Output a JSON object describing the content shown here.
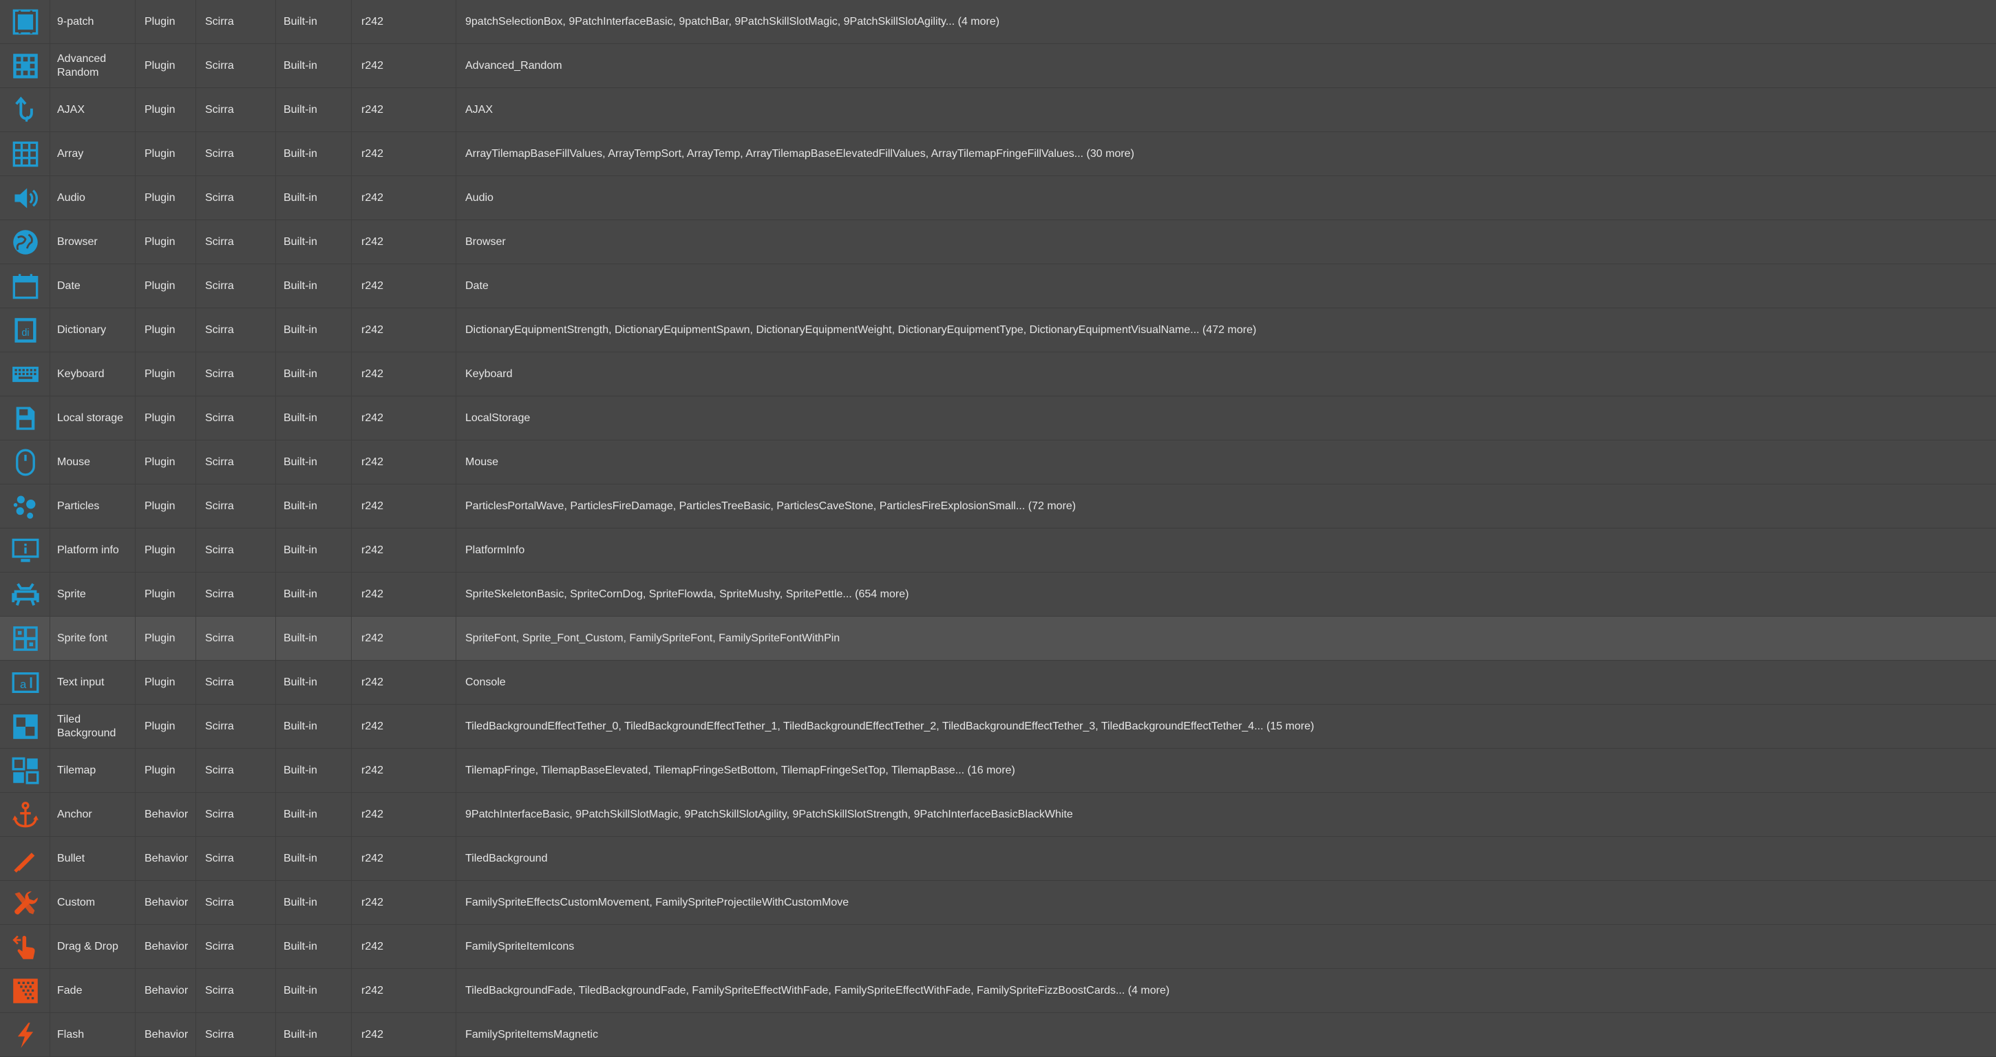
{
  "colors": {
    "plugin_icon": "#1f9ad0",
    "behavior_icon": "#e8501a",
    "row_bg": "#474747",
    "selected_row_bg": "#535353"
  },
  "rows": [
    {
      "name": "9-patch",
      "type": "Plugin",
      "author": "Scirra",
      "version": "Built-in",
      "revision": "r242",
      "used_by": "9patchSelectionBox, 9PatchInterfaceBasic, 9patchBar, 9PatchSkillSlotMagic, 9PatchSkillSlotAgility... (4 more)",
      "icon": "nine-patch-icon"
    },
    {
      "name": "Advanced Random",
      "type": "Plugin",
      "author": "Scirra",
      "version": "Built-in",
      "revision": "r242",
      "used_by": "Advanced_Random",
      "icon": "dice-grid-icon"
    },
    {
      "name": "AJAX",
      "type": "Plugin",
      "author": "Scirra",
      "version": "Built-in",
      "revision": "r242",
      "used_by": "AJAX",
      "icon": "ajax-arrows-icon"
    },
    {
      "name": "Array",
      "type": "Plugin",
      "author": "Scirra",
      "version": "Built-in",
      "revision": "r242",
      "used_by": "ArrayTilemapBaseFillValues, ArrayTempSort, ArrayTemp, ArrayTilemapBaseElevatedFillValues, ArrayTilemapFringeFillValues... (30 more)",
      "icon": "grid-icon"
    },
    {
      "name": "Audio",
      "type": "Plugin",
      "author": "Scirra",
      "version": "Built-in",
      "revision": "r242",
      "used_by": "Audio",
      "icon": "speaker-icon"
    },
    {
      "name": "Browser",
      "type": "Plugin",
      "author": "Scirra",
      "version": "Built-in",
      "revision": "r242",
      "used_by": "Browser",
      "icon": "globe-icon"
    },
    {
      "name": "Date",
      "type": "Plugin",
      "author": "Scirra",
      "version": "Built-in",
      "revision": "r242",
      "used_by": "Date",
      "icon": "calendar-icon"
    },
    {
      "name": "Dictionary",
      "type": "Plugin",
      "author": "Scirra",
      "version": "Built-in",
      "revision": "r242",
      "used_by": "DictionaryEquipmentStrength, DictionaryEquipmentSpawn, DictionaryEquipmentWeight, DictionaryEquipmentType, DictionaryEquipmentVisualName... (472 more)",
      "icon": "book-icon"
    },
    {
      "name": "Keyboard",
      "type": "Plugin",
      "author": "Scirra",
      "version": "Built-in",
      "revision": "r242",
      "used_by": "Keyboard",
      "icon": "keyboard-icon"
    },
    {
      "name": "Local storage",
      "type": "Plugin",
      "author": "Scirra",
      "version": "Built-in",
      "revision": "r242",
      "used_by": "LocalStorage",
      "icon": "storage-icon"
    },
    {
      "name": "Mouse",
      "type": "Plugin",
      "author": "Scirra",
      "version": "Built-in",
      "revision": "r242",
      "used_by": "Mouse",
      "icon": "mouse-icon"
    },
    {
      "name": "Particles",
      "type": "Plugin",
      "author": "Scirra",
      "version": "Built-in",
      "revision": "r242",
      "used_by": "ParticlesPortalWave, ParticlesFireDamage, ParticlesTreeBasic, ParticlesCaveStone, ParticlesFireExplosionSmall... (72 more)",
      "icon": "particles-icon"
    },
    {
      "name": "Platform info",
      "type": "Plugin",
      "author": "Scirra",
      "version": "Built-in",
      "revision": "r242",
      "used_by": "PlatformInfo",
      "icon": "monitor-info-icon"
    },
    {
      "name": "Sprite",
      "type": "Plugin",
      "author": "Scirra",
      "version": "Built-in",
      "revision": "r242",
      "used_by": "SpriteSkeletonBasic, SpriteCornDog, SpriteFlowda, SpriteMushy, SpritePettle... (654 more)",
      "icon": "invader-icon"
    },
    {
      "name": "Sprite font",
      "type": "Plugin",
      "author": "Scirra",
      "version": "Built-in",
      "revision": "r242",
      "used_by": "SpriteFont, Sprite_Font_Custom, FamilySpriteFont, FamilySpriteFontWithPin",
      "icon": "sprite-font-icon",
      "selected": true
    },
    {
      "name": "Text input",
      "type": "Plugin",
      "author": "Scirra",
      "version": "Built-in",
      "revision": "r242",
      "used_by": "Console",
      "icon": "text-input-icon"
    },
    {
      "name": "Tiled Background",
      "type": "Plugin",
      "author": "Scirra",
      "version": "Built-in",
      "revision": "r242",
      "used_by": "TiledBackgroundEffectTether_0, TiledBackgroundEffectTether_1, TiledBackgroundEffectTether_2, TiledBackgroundEffectTether_3, TiledBackgroundEffectTether_4... (15 more)",
      "icon": "checker-icon"
    },
    {
      "name": "Tilemap",
      "type": "Plugin",
      "author": "Scirra",
      "version": "Built-in",
      "revision": "r242",
      "used_by": "TilemapFringe, TilemapBaseElevated, TilemapFringeSetBottom, TilemapFringeSetTop, TilemapBase... (16 more)",
      "icon": "tilemap-icon"
    },
    {
      "name": "Anchor",
      "type": "Behavior",
      "author": "Scirra",
      "version": "Built-in",
      "revision": "r242",
      "used_by": "9PatchInterfaceBasic, 9PatchSkillSlotMagic, 9PatchSkillSlotAgility, 9PatchSkillSlotStrength, 9PatchInterfaceBasicBlackWhite",
      "icon": "anchor-icon"
    },
    {
      "name": "Bullet",
      "type": "Behavior",
      "author": "Scirra",
      "version": "Built-in",
      "revision": "r242",
      "used_by": "TiledBackground",
      "icon": "bullet-icon"
    },
    {
      "name": "Custom",
      "type": "Behavior",
      "author": "Scirra",
      "version": "Built-in",
      "revision": "r242",
      "used_by": "FamilySpriteEffectsCustomMovement, FamilySpriteProjectileWithCustomMove",
      "icon": "wrench-icon"
    },
    {
      "name": "Drag & Drop",
      "type": "Behavior",
      "author": "Scirra",
      "version": "Built-in",
      "revision": "r242",
      "used_by": "FamilySpriteItemIcons",
      "icon": "drag-hand-icon"
    },
    {
      "name": "Fade",
      "type": "Behavior",
      "author": "Scirra",
      "version": "Built-in",
      "revision": "r242",
      "used_by": "TiledBackgroundFade, TiledBackgroundFade, FamilySpriteEffectWithFade, FamilySpriteEffectWithFade, FamilySpriteFizzBoostCards... (4 more)",
      "icon": "fade-icon"
    },
    {
      "name": "Flash",
      "type": "Behavior",
      "author": "Scirra",
      "version": "Built-in",
      "revision": "r242",
      "used_by": "FamilySpriteItemsMagnetic",
      "icon": "lightning-icon"
    }
  ]
}
